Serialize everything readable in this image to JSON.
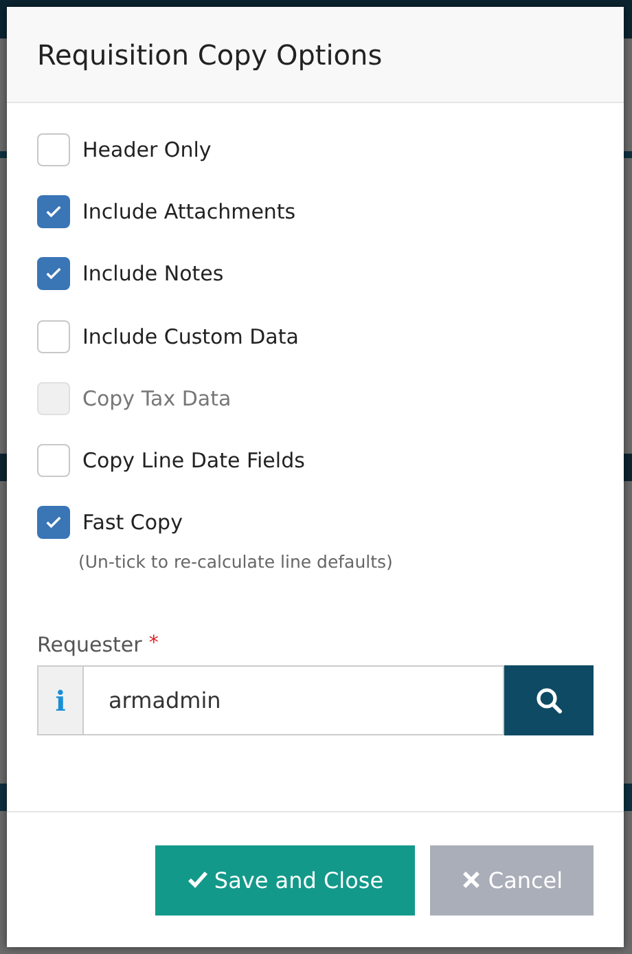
{
  "dialog": {
    "title": "Requisition Copy Options",
    "options": [
      {
        "label": "Header Only",
        "checked": false,
        "disabled": false
      },
      {
        "label": "Include Attachments",
        "checked": true,
        "disabled": false
      },
      {
        "label": "Include Notes",
        "checked": true,
        "disabled": false
      },
      {
        "label": "Include Custom Data",
        "checked": false,
        "disabled": false
      },
      {
        "label": "Copy Tax Data",
        "checked": false,
        "disabled": true
      },
      {
        "label": "Copy Line Date Fields",
        "checked": false,
        "disabled": false
      },
      {
        "label": "Fast Copy",
        "checked": true,
        "disabled": false,
        "note": "(Un-tick to re-calculate line defaults)"
      }
    ],
    "requester": {
      "label": "Requester",
      "required_mark": "*",
      "info": "i",
      "value": "armadmin"
    },
    "buttons": [
      {
        "label": "Save and Close",
        "kind": "save"
      },
      {
        "label": "Cancel",
        "kind": "cancel"
      }
    ]
  }
}
